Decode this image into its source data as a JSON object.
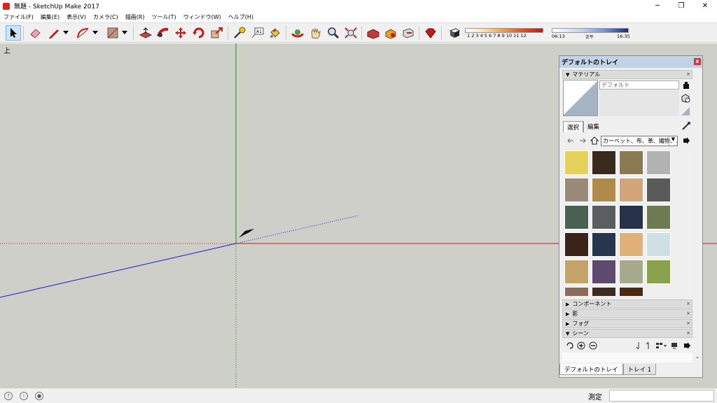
{
  "window": {
    "title": "無題 - SketchUp Make 2017",
    "min": "─",
    "max": "❐",
    "close": "✕"
  },
  "menu": [
    "ファイル(F)",
    "編集(E)",
    "表示(V)",
    "カメラ(C)",
    "描画(R)",
    "ツール(T)",
    "ウィンドウ(W)",
    "ヘルプ(H)"
  ],
  "shadow": {
    "months": "1  2  3  4  5  6  7  8  9  10 11 12"
  },
  "time": {
    "start": "06:13",
    "noon": "正午",
    "end": "16:35"
  },
  "viewport": {
    "label": "上"
  },
  "tray": {
    "title": "デフォルトのトレイ",
    "materials": {
      "header": "マテリアル",
      "name": "デフォルト",
      "tab_select": "選択",
      "tab_edit": "編集",
      "library": "カーペット、布、革、繊物、...",
      "swatch_colors": [
        "#e6d25a",
        "#3a2a1e",
        "#8a7a52",
        "#b2b2b2",
        "#9a8a7a",
        "#b08a48",
        "#d4a47a",
        "#5a5a5a",
        "#4a6052",
        "#5a5e62",
        "#25324a",
        "#6e7a52",
        "#3a2418",
        "#27354e",
        "#e0b27a",
        "#cfe0e4",
        "#c4a26a",
        "#5e4a6e",
        "#a6aa8a",
        "#8aa24e",
        "#8a6a5a",
        "#3e2a20",
        "#4a2812"
      ]
    },
    "panels": [
      {
        "label": "コンポーネント"
      },
      {
        "label": "影"
      },
      {
        "label": "フォグ"
      },
      {
        "label": "シーン"
      }
    ],
    "bottom_tabs": [
      "デフォルトのトレイ",
      "トレイ 1"
    ]
  },
  "status": {
    "measure_label": "測定",
    "measure_value": ""
  }
}
